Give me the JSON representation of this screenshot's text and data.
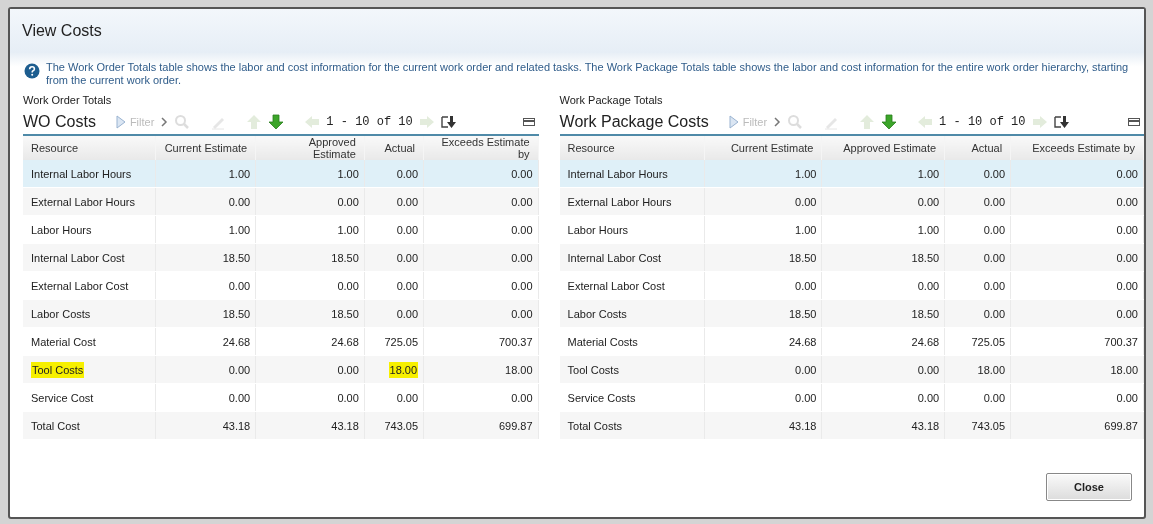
{
  "dialog": {
    "title": "View Costs",
    "info": "The Work Order Totals table shows the labor and cost information for the current work order and related tasks. The Work Package Totals table shows the labor and cost information for the entire work order hierarchy, starting from the current work order.",
    "close_button": "Close"
  },
  "panels": [
    {
      "section": "Work Order Totals",
      "title": "WO Costs",
      "filter": "Filter",
      "pager": "1 - 10 of 10",
      "columns": [
        "Resource",
        "Current Estimate",
        "Approved Estimate",
        "Actual",
        "Exceeds Estimate by"
      ],
      "rows": [
        {
          "selected": true,
          "cells": [
            "Internal Labor Hours",
            "1.00",
            "1.00",
            "0.00",
            "0.00"
          ]
        },
        {
          "selected": false,
          "cells": [
            "External Labor Hours",
            "0.00",
            "0.00",
            "0.00",
            "0.00"
          ]
        },
        {
          "selected": false,
          "cells": [
            "Labor Hours",
            "1.00",
            "1.00",
            "0.00",
            "0.00"
          ]
        },
        {
          "selected": false,
          "cells": [
            "Internal Labor Cost",
            "18.50",
            "18.50",
            "0.00",
            "0.00"
          ]
        },
        {
          "selected": false,
          "cells": [
            "External Labor Cost",
            "0.00",
            "0.00",
            "0.00",
            "0.00"
          ]
        },
        {
          "selected": false,
          "cells": [
            "Labor Costs",
            "18.50",
            "18.50",
            "0.00",
            "0.00"
          ]
        },
        {
          "selected": false,
          "cells": [
            "Material Cost",
            "24.68",
            "24.68",
            "725.05",
            "700.37"
          ]
        },
        {
          "selected": false,
          "cells": [
            "Tool Costs",
            "0.00",
            "0.00",
            "18.00",
            "18.00"
          ],
          "highlighted": [
            true,
            false,
            false,
            true,
            false
          ]
        },
        {
          "selected": false,
          "cells": [
            "Service Cost",
            "0.00",
            "0.00",
            "0.00",
            "0.00"
          ]
        },
        {
          "selected": false,
          "cells": [
            "Total Cost",
            "43.18",
            "43.18",
            "743.05",
            "699.87"
          ]
        }
      ]
    },
    {
      "section": "Work Package Totals",
      "title": "Work Package Costs",
      "filter": "Filter",
      "pager": "1 - 10 of 10",
      "columns": [
        "Resource",
        "Current Estimate",
        "Approved Estimate",
        "Actual",
        "Exceeds Estimate by"
      ],
      "rows": [
        {
          "selected": true,
          "cells": [
            "Internal Labor Hours",
            "1.00",
            "1.00",
            "0.00",
            "0.00"
          ]
        },
        {
          "selected": false,
          "cells": [
            "External Labor Hours",
            "0.00",
            "0.00",
            "0.00",
            "0.00"
          ]
        },
        {
          "selected": false,
          "cells": [
            "Labor Hours",
            "1.00",
            "1.00",
            "0.00",
            "0.00"
          ]
        },
        {
          "selected": false,
          "cells": [
            "Internal Labor Cost",
            "18.50",
            "18.50",
            "0.00",
            "0.00"
          ]
        },
        {
          "selected": false,
          "cells": [
            "External Labor Cost",
            "0.00",
            "0.00",
            "0.00",
            "0.00"
          ]
        },
        {
          "selected": false,
          "cells": [
            "Labor Costs",
            "18.50",
            "18.50",
            "0.00",
            "0.00"
          ]
        },
        {
          "selected": false,
          "cells": [
            "Material Costs",
            "24.68",
            "24.68",
            "725.05",
            "700.37"
          ]
        },
        {
          "selected": false,
          "cells": [
            "Tool Costs",
            "0.00",
            "0.00",
            "18.00",
            "18.00"
          ]
        },
        {
          "selected": false,
          "cells": [
            "Service Costs",
            "0.00",
            "0.00",
            "0.00",
            "0.00"
          ]
        },
        {
          "selected": false,
          "cells": [
            "Total Costs",
            "43.18",
            "43.18",
            "743.05",
            "699.87"
          ]
        }
      ]
    }
  ]
}
